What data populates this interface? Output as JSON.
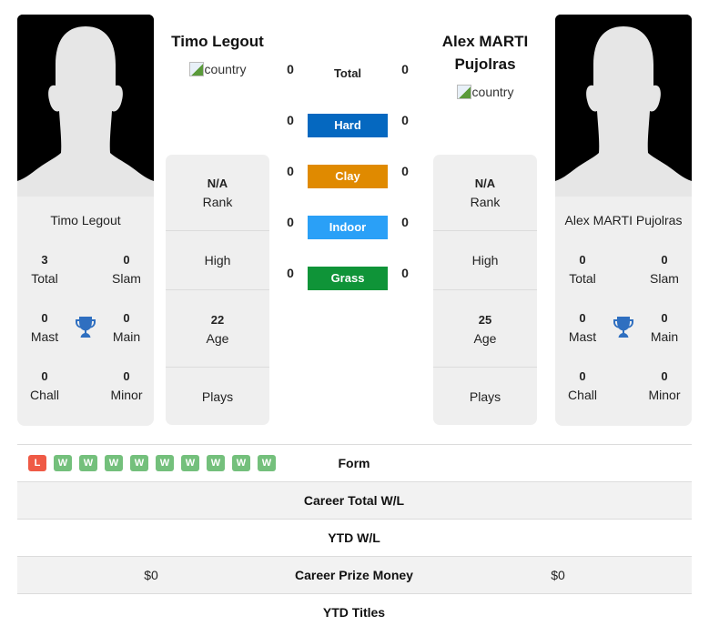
{
  "colors": {
    "hard": "#0568c0",
    "clay": "#e08a00",
    "indoor": "#2aa0f7",
    "grass": "#0f9438",
    "win": "#74c07c",
    "loss": "#ef5a46",
    "trophy": "#2f6fc0"
  },
  "player1": {
    "name": "Timo Legout",
    "country_alt": "country",
    "card": {
      "name": "Timo Legout",
      "total": {
        "value": "3",
        "label": "Total"
      },
      "slam": {
        "value": "0",
        "label": "Slam"
      },
      "mast": {
        "value": "0",
        "label": "Mast"
      },
      "main": {
        "value": "0",
        "label": "Main"
      },
      "chall": {
        "value": "0",
        "label": "Chall"
      },
      "minor": {
        "value": "0",
        "label": "Minor"
      }
    },
    "info": {
      "rank_value": "N/A",
      "rank_label": "Rank",
      "high_label": "High",
      "age_value": "22",
      "age_label": "Age",
      "plays_label": "Plays"
    }
  },
  "player2": {
    "name": "Alex MARTI Pujolras",
    "name_line1": "Alex MARTI",
    "name_line2": "Pujolras",
    "country_alt": "country",
    "card": {
      "name": "Alex MARTI Pujolras",
      "total": {
        "value": "0",
        "label": "Total"
      },
      "slam": {
        "value": "0",
        "label": "Slam"
      },
      "mast": {
        "value": "0",
        "label": "Mast"
      },
      "main": {
        "value": "0",
        "label": "Main"
      },
      "chall": {
        "value": "0",
        "label": "Chall"
      },
      "minor": {
        "value": "0",
        "label": "Minor"
      }
    },
    "info": {
      "rank_value": "N/A",
      "rank_label": "Rank",
      "high_label": "High",
      "age_value": "25",
      "age_label": "Age",
      "plays_label": "Plays"
    }
  },
  "h2h": {
    "total": {
      "label": "Total",
      "p1": "0",
      "p2": "0"
    },
    "surfaces": [
      {
        "label": "Hard",
        "p1": "0",
        "p2": "0",
        "color_key": "hard"
      },
      {
        "label": "Clay",
        "p1": "0",
        "p2": "0",
        "color_key": "clay"
      },
      {
        "label": "Indoor",
        "p1": "0",
        "p2": "0",
        "color_key": "indoor"
      },
      {
        "label": "Grass",
        "p1": "0",
        "p2": "0",
        "color_key": "grass"
      }
    ]
  },
  "table": {
    "form": {
      "label": "Form",
      "p1_results": [
        "L",
        "W",
        "W",
        "W",
        "W",
        "W",
        "W",
        "W",
        "W",
        "W"
      ]
    },
    "rows": [
      {
        "label": "Career Total W/L",
        "p1": "",
        "p2": ""
      },
      {
        "label": "YTD W/L",
        "p1": "",
        "p2": ""
      },
      {
        "label": "Career Prize Money",
        "p1": "$0",
        "p2": "$0"
      },
      {
        "label": "YTD Titles",
        "p1": "",
        "p2": ""
      }
    ]
  }
}
